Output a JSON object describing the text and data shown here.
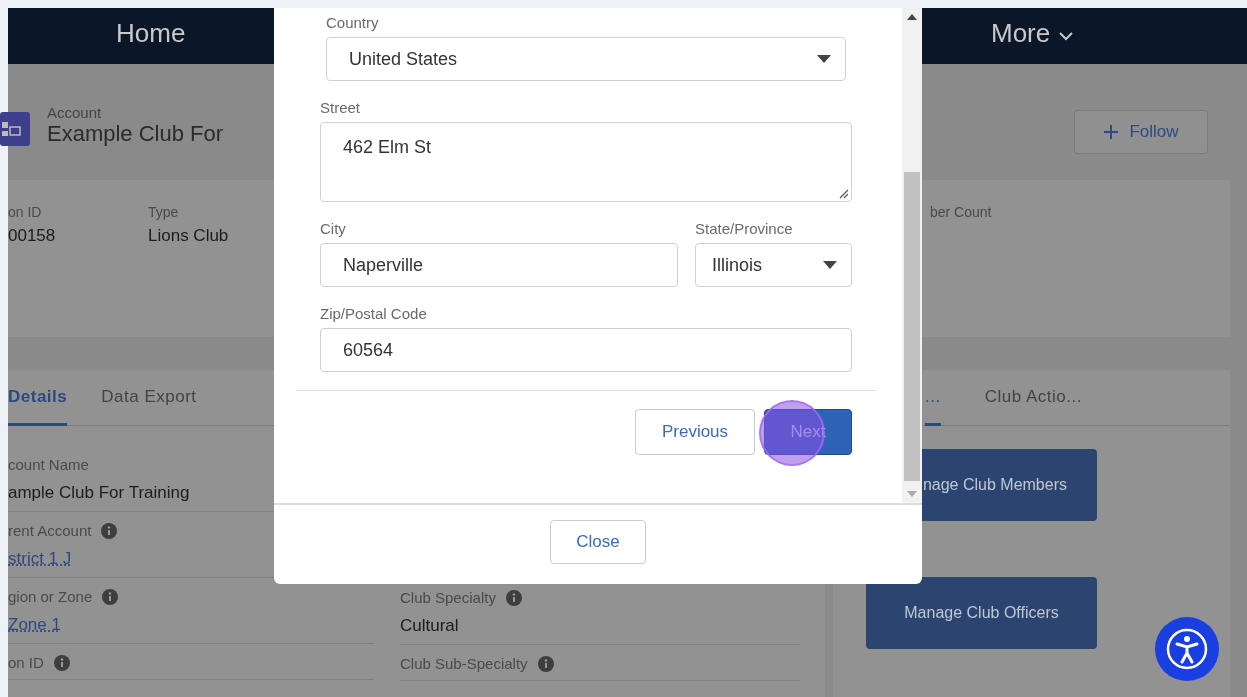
{
  "nav": {
    "items": [
      {
        "label": "Home"
      },
      {
        "label": "More",
        "caret": true
      }
    ]
  },
  "record": {
    "object": "Account",
    "name": "Example Club For",
    "follow": "Follow"
  },
  "highlights": [
    {
      "label": "on ID",
      "value": "00158"
    },
    {
      "label": "Type",
      "value": "Lions Club"
    },
    {
      "label": "ber Count"
    }
  ],
  "details_tabs": [
    {
      "label": "Details",
      "selected": true
    },
    {
      "label": "Data Export",
      "selected": false
    }
  ],
  "details_left": [
    {
      "label": "count Name",
      "value": "ample Club For Training",
      "info": false,
      "link": false
    },
    {
      "label": "rent Account",
      "value": "strict 1 J",
      "info": true,
      "link": true
    },
    {
      "label": "gion or Zone",
      "value": "Zone 1",
      "info": true,
      "link": true
    },
    {
      "label": "on ID",
      "info": true,
      "link": false
    }
  ],
  "details_right": [
    {
      "label": "Club Specialty",
      "value": "Cultural",
      "info": true,
      "link": false
    },
    {
      "label": "Club Sub-Specialty",
      "info": true,
      "link": false
    }
  ],
  "actions_tabs": [
    {
      "label": "...",
      "selected": true
    },
    {
      "label": "Club Actio...",
      "selected": false
    }
  ],
  "action_buttons": [
    "nage Club Members",
    "Manage Club Officers"
  ],
  "modal": {
    "rows": [
      [
        {
          "label": "Country",
          "kind": "select",
          "value": "United States"
        }
      ],
      [
        {
          "label": "Street",
          "kind": "textarea",
          "value": "462 Elm St"
        }
      ],
      [
        {
          "label": "City",
          "kind": "input",
          "value": "Naperville"
        },
        {
          "label": "State/Province",
          "kind": "select",
          "value": "Illinois"
        }
      ],
      [
        {
          "label": "Zip/Postal Code",
          "kind": "input",
          "value": "60564"
        }
      ]
    ],
    "buttons": [
      {
        "label": "Previous",
        "kind": "neutral"
      },
      {
        "label": "Next",
        "kind": "brand"
      }
    ],
    "close": "Close"
  }
}
